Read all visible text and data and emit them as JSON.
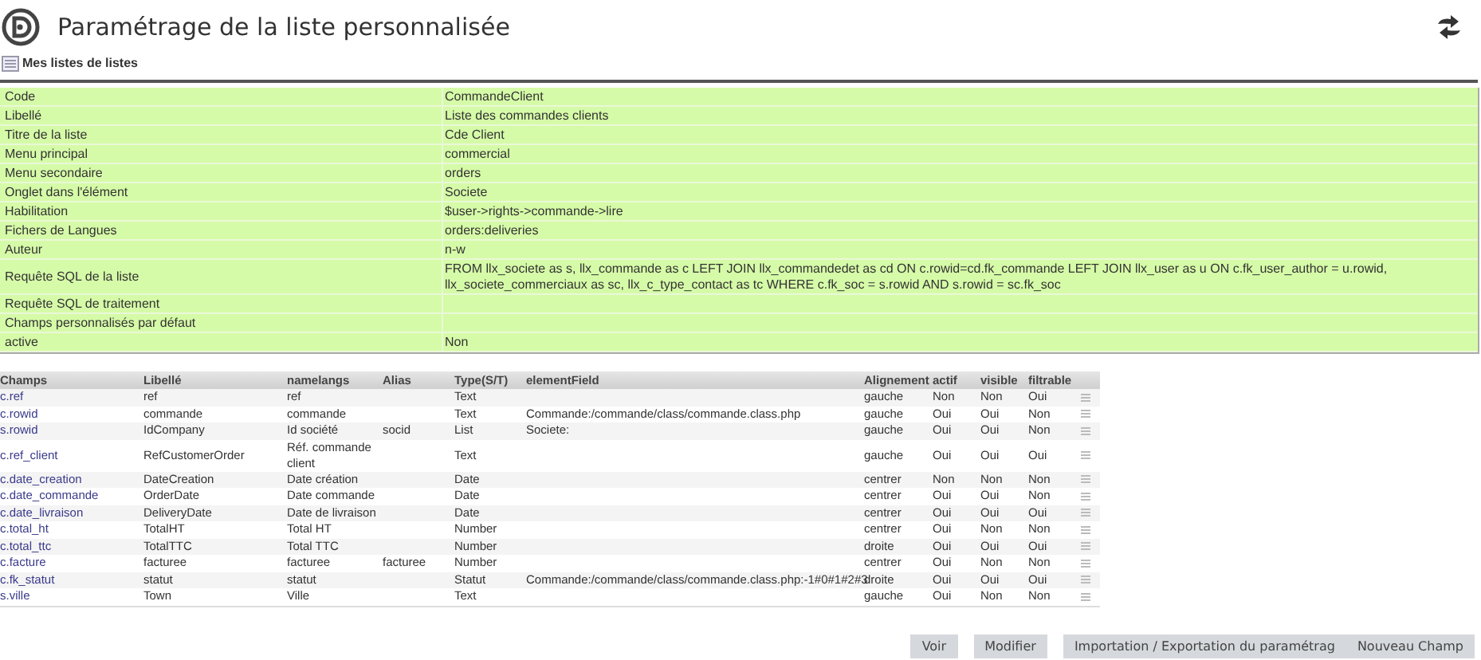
{
  "page": {
    "title": "Paramétrage de la liste personnalisée",
    "breadcrumb_link": "Mes listes de listes"
  },
  "properties": [
    {
      "label": "Code",
      "value": "CommandeClient"
    },
    {
      "label": "Libellé",
      "value": "Liste des commandes clients"
    },
    {
      "label": "Titre de la liste",
      "value": "Cde Client"
    },
    {
      "label": "Menu principal",
      "value": "commercial"
    },
    {
      "label": "Menu secondaire",
      "value": "orders"
    },
    {
      "label": "Onglet dans l'élément",
      "value": "Societe"
    },
    {
      "label": "Habilitation",
      "value": "$user->rights->commande->lire"
    },
    {
      "label": "Fichers de Langues",
      "value": "orders:deliveries"
    },
    {
      "label": "Auteur",
      "value": "n-w"
    },
    {
      "label": "Requête SQL de la liste",
      "value": "FROM llx_societe as s, llx_commande as c LEFT JOIN llx_commandedet as cd ON c.rowid=cd.fk_commande LEFT JOIN llx_user as u ON c.fk_user_author = u.rowid, llx_societe_commerciaux as sc, llx_c_type_contact as tc WHERE c.fk_soc = s.rowid AND s.rowid = sc.fk_soc"
    },
    {
      "label": "Requête SQL de traitement"
    },
    {
      "label": "Champs personnalisés par défaut"
    },
    {
      "label": "active",
      "value": "Non"
    }
  ],
  "fields_table": {
    "columns": [
      "Champs",
      "Libellé",
      "namelangs",
      "Alias",
      "Type(S/T)",
      "elementField",
      "Alignement",
      "actif",
      "visible",
      "filtrable"
    ],
    "rows": [
      [
        "c.ref",
        "ref",
        "ref",
        "",
        "Text",
        "",
        "gauche",
        "Non",
        "Non",
        "Oui"
      ],
      [
        "c.rowid",
        "commande",
        "commande",
        "",
        "Text",
        "Commande:/commande/class/commande.class.php",
        "gauche",
        "Oui",
        "Oui",
        "Non"
      ],
      [
        "s.rowid",
        "IdCompany",
        "Id société",
        "socid",
        "List",
        "Societe:",
        "gauche",
        "Oui",
        "Oui",
        "Non"
      ],
      [
        "c.ref_client",
        "RefCustomerOrder",
        "Réf. commande client",
        "",
        "Text",
        "",
        "gauche",
        "Oui",
        "Oui",
        "Oui"
      ],
      [
        "c.date_creation",
        "DateCreation",
        "Date création",
        "",
        "Date",
        "",
        "centrer",
        "Non",
        "Non",
        "Non"
      ],
      [
        "c.date_commande",
        "OrderDate",
        "Date commande",
        "",
        "Date",
        "",
        "centrer",
        "Oui",
        "Oui",
        "Non"
      ],
      [
        "c.date_livraison",
        "DeliveryDate",
        "Date de livraison",
        "",
        "Date",
        "",
        "centrer",
        "Oui",
        "Oui",
        "Oui"
      ],
      [
        "c.total_ht",
        "TotalHT",
        "Total HT",
        "",
        "Number",
        "",
        "centrer",
        "Oui",
        "Non",
        "Non"
      ],
      [
        "c.total_ttc",
        "TotalTTC",
        "Total TTC",
        "",
        "Number",
        "",
        "droite",
        "Oui",
        "Oui",
        "Oui"
      ],
      [
        "c.facture",
        "facturee",
        "facturee",
        "facturee",
        "Number",
        "",
        "centrer",
        "Oui",
        "Non",
        "Non"
      ],
      [
        "c.fk_statut",
        "statut",
        "statut",
        "",
        "Statut",
        "Commande:/commande/class/commande.class.php:-1#0#1#2#3",
        "droite",
        "Oui",
        "Oui",
        "Oui"
      ],
      [
        "s.ville",
        "Town",
        "Ville",
        "",
        "Text",
        "",
        "gauche",
        "Oui",
        "Non",
        "Non"
      ]
    ]
  },
  "buttons": [
    "Voir",
    "Modifier",
    "Importation / Exportation du paramétrag",
    "Nouveau Champ"
  ]
}
